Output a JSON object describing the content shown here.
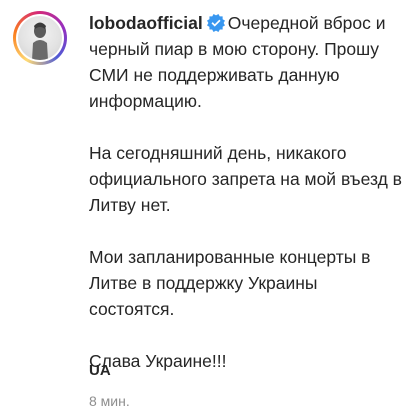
{
  "post": {
    "username": "lobodaofficial",
    "verified": true,
    "caption": "Очередной вброс и черный пиар в мою сторону. Прошу СМИ не поддерживать данную информацию.\n\nНа сегодняшний день, никакого официального запрета на мой въезд в Литву нет.\n\nМои запланированные концерты в Литве в поддержку Украины состоятся.\n\nСлава Украине!!!",
    "hashtag": "UA",
    "timestamp": "8 мин."
  },
  "colors": {
    "text": "#262626",
    "secondary_text": "#8e8e8e",
    "verified_badge": "#3897f0"
  },
  "icons": {
    "verified": "verified-badge-icon",
    "avatar": "profile-avatar"
  }
}
